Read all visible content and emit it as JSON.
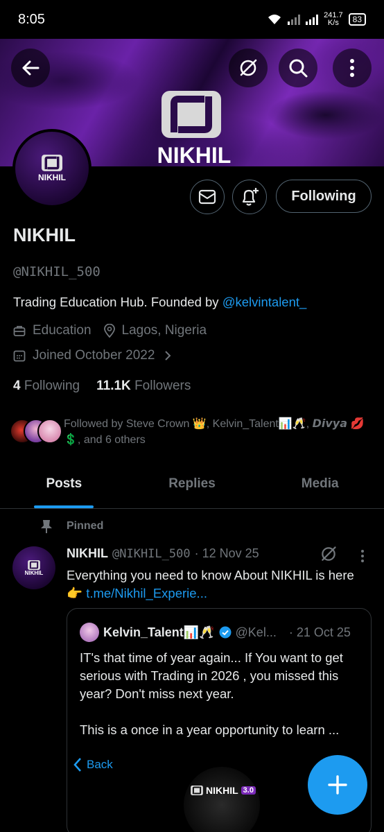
{
  "status_bar": {
    "time": "8:05",
    "net_speed_value": "241.7",
    "net_speed_unit": "K/s",
    "battery": "83"
  },
  "banner": {
    "title": "NIKHIL"
  },
  "avatar": {
    "label": "NIKHIL"
  },
  "actions": {
    "following_label": "Following"
  },
  "profile": {
    "name": "NIKHIL",
    "handle": "@NIKHIL_500",
    "bio_text": "Trading Education Hub.  Founded by ",
    "bio_link": "@kelvintalent_",
    "category": "Education",
    "location": "Lagos, Nigeria",
    "joined": "Joined October 2022",
    "following_count": "4",
    "following_label": "Following",
    "followers_count": "11.1K",
    "followers_label": "Followers",
    "followed_by_line1": "Followed by Steve Crown 👑, Kelvin_Talent📊🥂, 𝘿𝙞𝙫𝙮𝙖 💋",
    "followed_by_line2": "💲, and 6 others"
  },
  "tabs": [
    {
      "label": "Posts",
      "active": true
    },
    {
      "label": "Replies",
      "active": false
    },
    {
      "label": "Media",
      "active": false
    }
  ],
  "pinned_post": {
    "pinned_label": "Pinned",
    "avatar_label": "NIKHIL",
    "author": "NIKHIL",
    "handle": "@NIKHIL_500",
    "date": "· 12 Nov 25",
    "text": "Everything you need to know About NIKHIL is here 👉 ",
    "link": "t.me/Nikhil_Experie...",
    "quote": {
      "author": "Kelvin_Talent📊🥂",
      "handle": "@Kel...",
      "date": "· 21 Oct 25",
      "text": "IT's that time of year again... If You want to get serious with Trading in 2026 , you missed this year? Don't miss next year.\n\nThis is a once in a year opportunity to learn ...",
      "back_label": "Back",
      "media_label": "NIKHIL",
      "media_badge": "3.0"
    }
  },
  "colors": {
    "accent": "#1d9bf0",
    "muted": "#71767b",
    "text": "#e7e9ea",
    "border": "#2f3336"
  }
}
